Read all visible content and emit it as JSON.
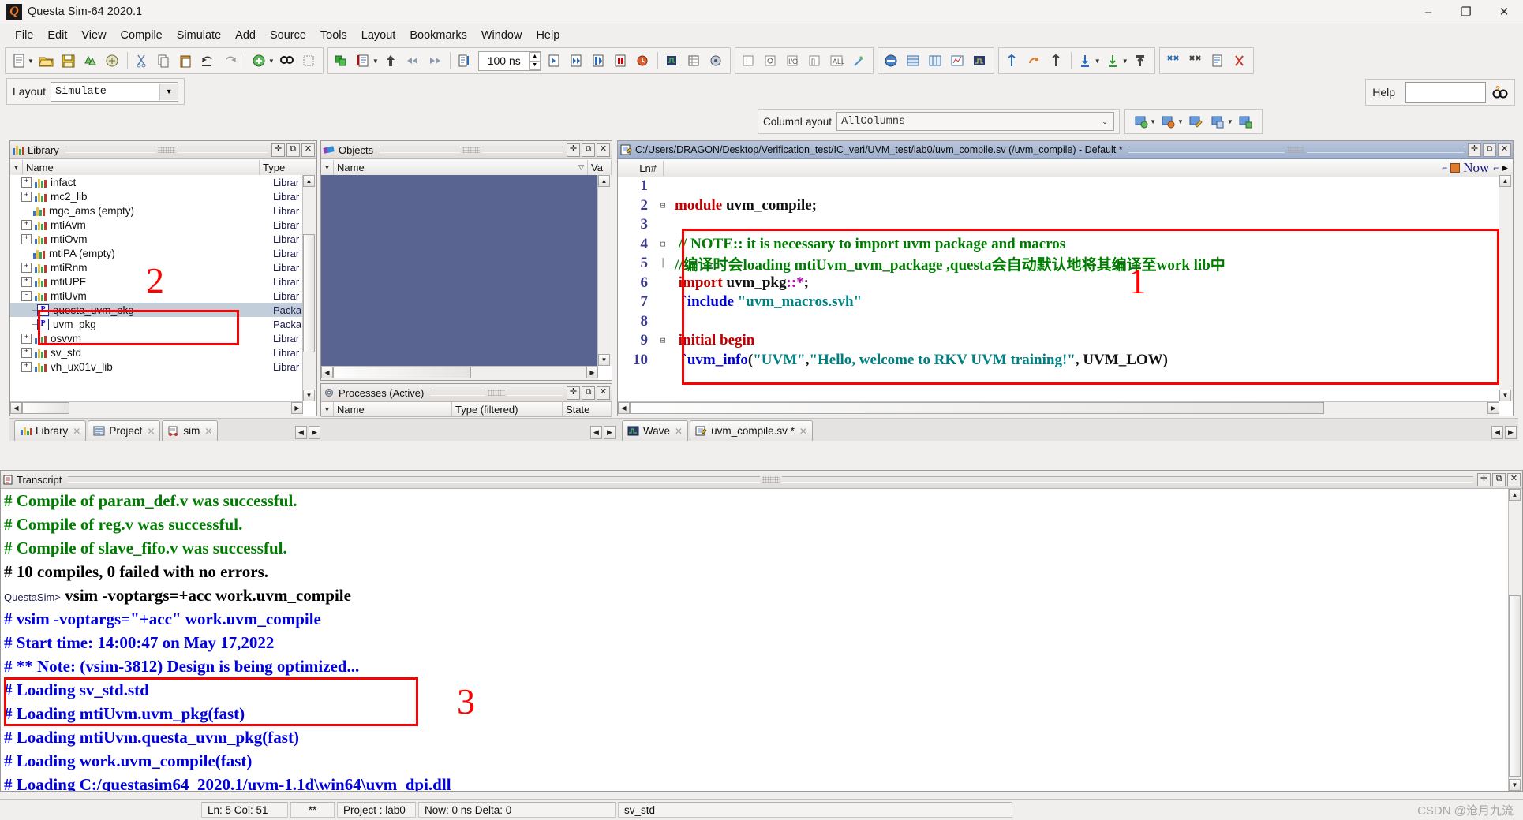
{
  "window": {
    "title": "Questa Sim-64 2020.1",
    "logo_text": "Q",
    "minimize": "–",
    "maximize": "❐",
    "close": "✕"
  },
  "menu": {
    "items": [
      "File",
      "Edit",
      "View",
      "Compile",
      "Simulate",
      "Add",
      "Source",
      "Tools",
      "Layout",
      "Bookmarks",
      "Window",
      "Help"
    ]
  },
  "toolbar": {
    "time_value": "100 ns",
    "groups": [
      {
        "name": "file-group",
        "buttons": [
          "new-file-icon",
          "open-icon",
          "save-icon",
          "compile-icon",
          "compile-all-icon",
          "cut-icon",
          "copy-icon",
          "paste-icon",
          "undo-icon",
          "redo-icon",
          "add-icon",
          "find-icon",
          "find-all-icon"
        ]
      },
      {
        "name": "simulate-group",
        "buttons": [
          "simulate-icon",
          "sim-opts-icon",
          "up-icon",
          "back-icon",
          "forward-icon",
          "runlen-icon"
        ]
      },
      {
        "name": "run-group",
        "buttons": [
          "run-icon",
          "continue-icon",
          "run-all-icon",
          "break-icon",
          "restart-icon",
          "wave-icon",
          "list-icon",
          "process-icon"
        ]
      },
      {
        "name": "step-group",
        "buttons": [
          "step-icon",
          "step-over-icon",
          "step-out-icon",
          "attr-icon"
        ]
      },
      {
        "name": "memory-group",
        "buttons": [
          "mem-icon",
          "mem2-icon",
          "mem3-icon",
          "mem4-icon",
          "mem5-icon"
        ]
      },
      {
        "name": "wave-group",
        "buttons": [
          "wave1-icon",
          "wave2-icon",
          "wave3-icon",
          "wave4-icon",
          "wave5-icon",
          "wave6-icon",
          "wave7-icon"
        ]
      },
      {
        "name": "cursor-group",
        "buttons": [
          "cursor1-icon",
          "cursor2-icon",
          "doc-icon",
          "delete-icon"
        ]
      }
    ]
  },
  "layout_bar": {
    "label": "Layout",
    "value": "Simulate",
    "help_label": "Help",
    "help_value": "",
    "help_icon": "help-search-icon"
  },
  "column_bar": {
    "label": "ColumnLayout",
    "value": "AllColumns",
    "buttons": [
      "add-col-icon",
      "remove-col-icon",
      "edit-col-icon",
      "save-col-icon",
      "new-col-icon"
    ]
  },
  "library_pane": {
    "title": "Library",
    "columns": [
      "Name",
      "Type"
    ],
    "rows": [
      {
        "name": "infact",
        "type": "Librar",
        "expander": "+",
        "icon": "library-icon",
        "level": 0,
        "selected": false
      },
      {
        "name": "mc2_lib",
        "type": "Librar",
        "expander": "+",
        "icon": "library-icon",
        "level": 0,
        "selected": false
      },
      {
        "name": "mgc_ams  (empty)",
        "type": "Librar",
        "expander": "",
        "icon": "library-icon",
        "level": 0,
        "selected": false
      },
      {
        "name": "mtiAvm",
        "type": "Librar",
        "expander": "+",
        "icon": "library-icon",
        "level": 0,
        "selected": false
      },
      {
        "name": "mtiOvm",
        "type": "Librar",
        "expander": "+",
        "icon": "library-icon",
        "level": 0,
        "selected": false
      },
      {
        "name": "mtiPA  (empty)",
        "type": "Librar",
        "expander": "",
        "icon": "library-icon",
        "level": 0,
        "selected": false
      },
      {
        "name": "mtiRnm",
        "type": "Librar",
        "expander": "+",
        "icon": "library-icon",
        "level": 0,
        "selected": false
      },
      {
        "name": "mtiUPF",
        "type": "Librar",
        "expander": "+",
        "icon": "library-icon",
        "level": 0,
        "selected": false
      },
      {
        "name": "mtiUvm",
        "type": "Librar",
        "expander": "-",
        "icon": "library-icon",
        "level": 0,
        "selected": false
      },
      {
        "name": "questa_uvm_pkg",
        "type": "Packa",
        "expander": "",
        "icon": "package-icon",
        "level": 1,
        "selected": true
      },
      {
        "name": "uvm_pkg",
        "type": "Packa",
        "expander": "",
        "icon": "package-icon",
        "level": 1,
        "selected": false
      },
      {
        "name": "osvvm",
        "type": "Librar",
        "expander": "+",
        "icon": "library-icon",
        "level": 0,
        "selected": false
      },
      {
        "name": "sv_std",
        "type": "Librar",
        "expander": "+",
        "icon": "library-icon",
        "level": 0,
        "selected": false
      },
      {
        "name": "vh_ux01v_lib",
        "type": "Librar",
        "expander": "+",
        "icon": "library-icon",
        "level": 0,
        "selected": false
      }
    ]
  },
  "objects_pane": {
    "title": "Objects",
    "columns": [
      "Name",
      "Va"
    ],
    "rows": []
  },
  "processes_pane": {
    "title": "Processes (Active)",
    "columns": [
      "Name",
      "Type (filtered)",
      "State"
    ],
    "rows": []
  },
  "source_pane": {
    "title": "C:/Users/DRAGON/Desktop/Verification_test/IC_veri/UVM_test/lab0/uvm_compile.sv (/uvm_compile) - Default *",
    "gutter_label": "Ln#",
    "now_label": "Now",
    "lines": [
      {
        "num": "1",
        "fold": "",
        "segments": []
      },
      {
        "num": "2",
        "fold": "⊟",
        "segments": [
          {
            "t": "module ",
            "c": "kw"
          },
          {
            "t": "uvm_compile;",
            "c": "id"
          }
        ]
      },
      {
        "num": "3",
        "fold": "",
        "segments": []
      },
      {
        "num": "4",
        "fold": "⊟",
        "segments": [
          {
            "t": " // NOTE:: it is necessary to import uvm package and macros",
            "c": "cm"
          }
        ]
      },
      {
        "num": "5",
        "fold": "│",
        "segments": [
          {
            "t": "//编译时会loading mtiUvm_uvm_package ,questa会自动默认地将其编译至work lib中",
            "c": "cm"
          }
        ]
      },
      {
        "num": "6",
        "fold": "",
        "segments": [
          {
            "t": " import ",
            "c": "kw"
          },
          {
            "t": "uvm_pkg",
            "c": "id"
          },
          {
            "t": "::*",
            "c": "num"
          },
          {
            "t": ";",
            "c": "id"
          }
        ]
      },
      {
        "num": "7",
        "fold": "",
        "segments": [
          {
            "t": "  `include ",
            "c": "dir"
          },
          {
            "t": "\"uvm_macros.svh\"",
            "c": "str"
          }
        ]
      },
      {
        "num": "8",
        "fold": "",
        "segments": []
      },
      {
        "num": "9",
        "fold": "⊟",
        "segments": [
          {
            "t": " initial begin",
            "c": "kw"
          }
        ]
      },
      {
        "num": "10",
        "fold": "",
        "segments": [
          {
            "t": "  `uvm_info",
            "c": "dir"
          },
          {
            "t": "(",
            "c": "id"
          },
          {
            "t": "\"UVM\"",
            "c": "str"
          },
          {
            "t": ",",
            "c": "id"
          },
          {
            "t": "\"Hello, welcome to RKV UVM training!\"",
            "c": "str"
          },
          {
            "t": ", UVM_LOW)",
            "c": "id"
          }
        ]
      }
    ]
  },
  "left_tabs": [
    {
      "label": "Library",
      "icon": "library-icon",
      "active": true
    },
    {
      "label": "Project",
      "icon": "project-icon",
      "active": false
    },
    {
      "label": "sim",
      "icon": "sim-icon",
      "active": false
    }
  ],
  "right_tabs": [
    {
      "label": "Wave",
      "icon": "wave-icon",
      "active": false
    },
    {
      "label": "uvm_compile.sv *",
      "icon": "source-file-icon",
      "active": true
    }
  ],
  "transcript": {
    "title": "Transcript",
    "lines": [
      {
        "prompt": "",
        "text": "# Compile of param_def.v was successful.",
        "color": "tsgreen"
      },
      {
        "prompt": "",
        "text": "# Compile of reg.v was successful.",
        "color": "tsgreen"
      },
      {
        "prompt": "",
        "text": "# Compile of slave_fifo.v was successful.",
        "color": "tsgreen"
      },
      {
        "prompt": "",
        "text": "# 10 compiles, 0 failed with no errors.",
        "color": "tsblack"
      },
      {
        "prompt": "QuestaSim>",
        "text": " vsim -voptargs=+acc work.uvm_compile",
        "color": "tsblack"
      },
      {
        "prompt": "",
        "text": "# vsim -voptargs=\"+acc\" work.uvm_compile",
        "color": "tsblue"
      },
      {
        "prompt": "",
        "text": "# Start time: 14:00:47 on May 17,2022",
        "color": "tsblue"
      },
      {
        "prompt": "",
        "text": "# ** Note: (vsim-3812) Design is being optimized...",
        "color": "tsblue"
      },
      {
        "prompt": "",
        "text": "# Loading sv_std.std",
        "color": "tsblue"
      },
      {
        "prompt": "",
        "text": "# Loading mtiUvm.uvm_pkg(fast)",
        "color": "tsblue"
      },
      {
        "prompt": "",
        "text": "# Loading mtiUvm.questa_uvm_pkg(fast)",
        "color": "tsblue"
      },
      {
        "prompt": "",
        "text": "# Loading work.uvm_compile(fast)",
        "color": "tsblue"
      },
      {
        "prompt": "",
        "text": "# Loading C:/questasim64_2020.1/uvm-1.1d\\win64\\uvm_dpi.dll",
        "color": "tsblue"
      }
    ]
  },
  "statusbar": {
    "cells": [
      "Ln:   5 Col: 51",
      "**",
      "Project : lab0",
      "Now: 0 ns  Delta: 0",
      "sv_std"
    ],
    "watermark": "CSDN @沧月九流"
  },
  "annotations": [
    {
      "label": "1",
      "target": "source-code-highlight"
    },
    {
      "label": "2",
      "target": "library-uvm-packages-highlight"
    },
    {
      "label": "3",
      "target": "transcript-loading-highlight"
    }
  ],
  "colors": {
    "annotation_red": "#ff0000",
    "selection_blue": "#c3cedb",
    "objects_body": "#5a6490",
    "transcript_green": "#007d00",
    "transcript_blue": "#0000dd",
    "keyword_red": "#c00000"
  }
}
